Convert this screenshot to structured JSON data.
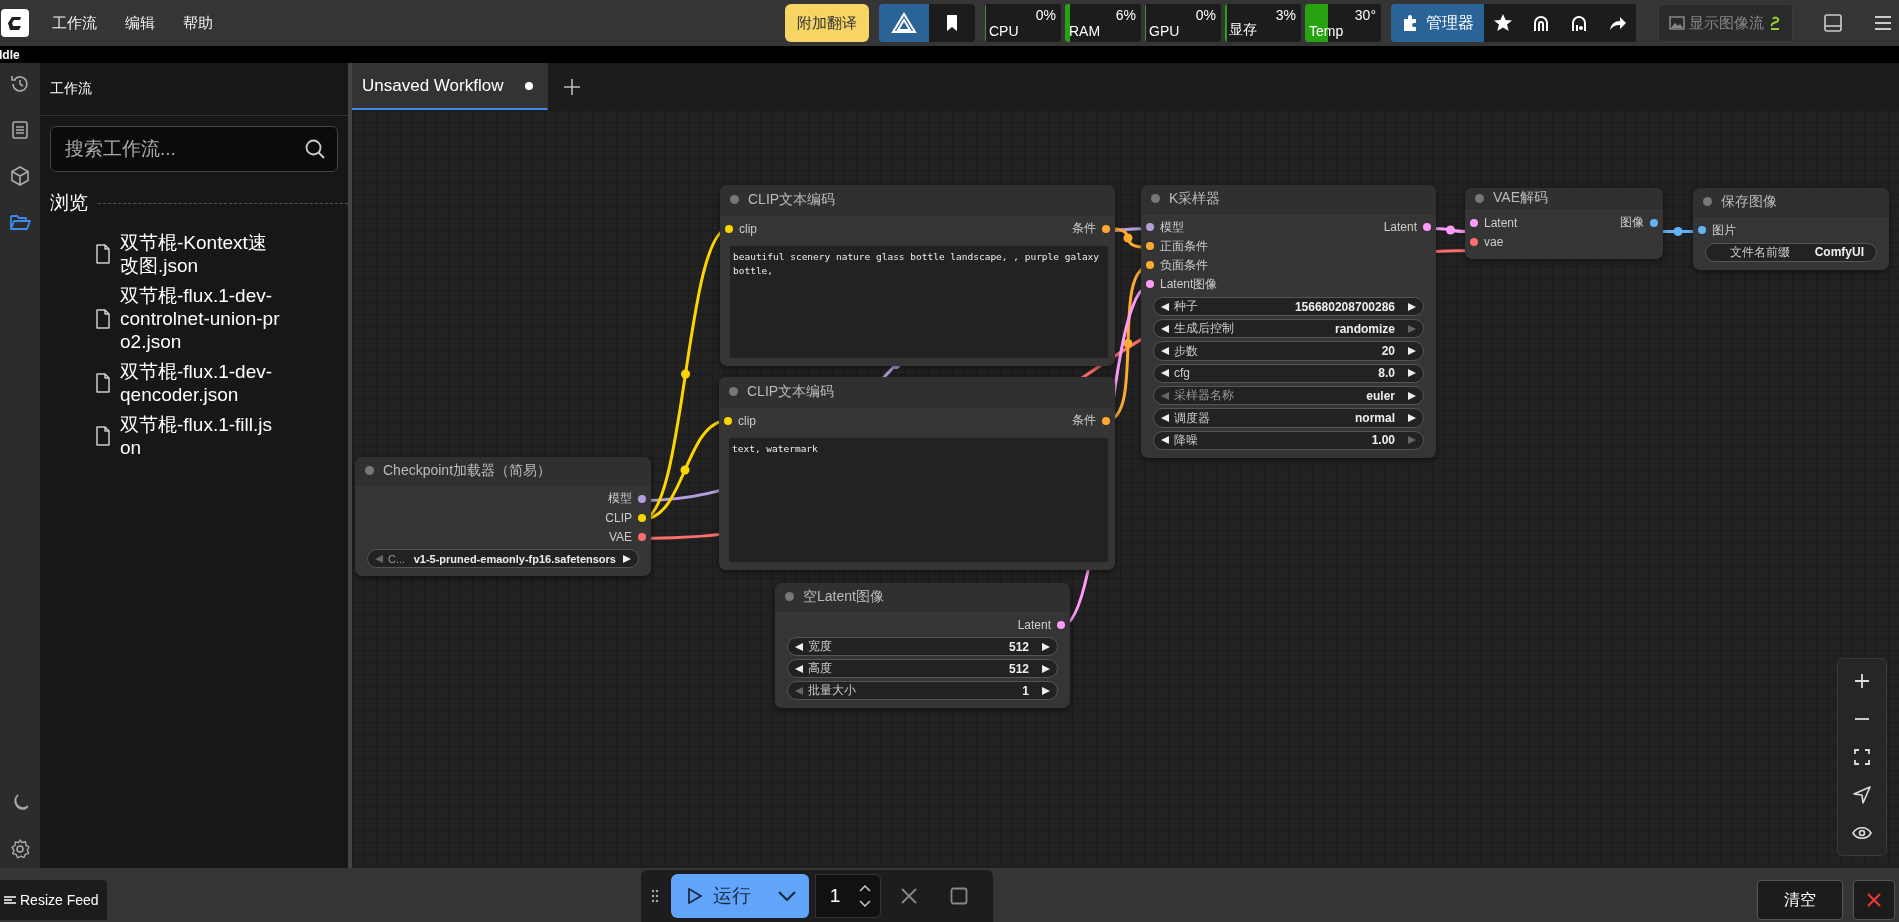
{
  "top_bar": {
    "menu": [
      {
        "label": "工作流"
      },
      {
        "label": "编辑"
      },
      {
        "label": "帮助"
      }
    ],
    "translate_button": "附加翻译",
    "monitors": [
      {
        "label": "CPU",
        "reading": "0%",
        "level": 0
      },
      {
        "label": "RAM",
        "reading": "6%",
        "level": 0.06
      },
      {
        "label": "GPU",
        "reading": "0%",
        "level": 0
      },
      {
        "label": "显存",
        "reading": "3%",
        "level": 0.03
      },
      {
        "label": "Temp",
        "reading": "30°",
        "level": 0.3
      }
    ],
    "manager_button": "管理器",
    "image_feed_button": "显示图像流"
  },
  "status": "Idle",
  "sidebar_tools": [
    {
      "kind": "history",
      "selected": false
    },
    {
      "kind": "queue",
      "selected": false
    },
    {
      "kind": "models",
      "selected": false
    },
    {
      "kind": "workflows",
      "selected": true
    }
  ],
  "workflows_panel": {
    "title": "工作流",
    "search": {
      "placeholder": "搜索工作流..."
    },
    "section": "浏览",
    "files": [
      "双节棍-Kontext速改图.json",
      "双节棍-flux.1-dev-controlnet-union-pro2.json",
      "双节棍-flux.1-dev-qencoder.json",
      "双节棍-flux.1-fill.json"
    ]
  },
  "tabs": [
    {
      "label": "Unsaved Workflow",
      "selected": true,
      "unsaved": true
    }
  ],
  "nodes": [
    {
      "title": "Checkpoint加载器（简易）",
      "outputs": [
        {
          "label": "模型",
          "color": "#b39ddb"
        },
        {
          "label": "CLIP",
          "color": "#ffd500"
        },
        {
          "label": "VAE",
          "color": "#ff6e6e"
        }
      ],
      "widgets": [
        {
          "kind": "combo",
          "label": "C...",
          "value": "v1-5-pruned-emaonly-fp16.safetensors",
          "at_min": true,
          "at_max": false
        }
      ]
    },
    {
      "title": "CLIP文本编码",
      "inputs": [
        {
          "label": "clip",
          "color": "#ffd500"
        }
      ],
      "outputs": [
        {
          "label": "条件",
          "color": "#ffa931"
        }
      ],
      "widgets": [
        {
          "kind": "textarea",
          "value": "beautiful scenery nature glass bottle landscape, , purple galaxy bottle,"
        }
      ]
    },
    {
      "title": "CLIP文本编码",
      "inputs": [
        {
          "label": "clip",
          "color": "#ffd500"
        }
      ],
      "outputs": [
        {
          "label": "条件",
          "color": "#ffa931"
        }
      ],
      "widgets": [
        {
          "kind": "textarea",
          "value": "text, watermark"
        }
      ]
    },
    {
      "title": "空Latent图像",
      "outputs": [
        {
          "label": "Latent",
          "color": "#ff9cf9"
        }
      ],
      "widgets": [
        {
          "kind": "number",
          "label": "宽度",
          "value": "512",
          "at_min": false,
          "at_max": false
        },
        {
          "kind": "number",
          "label": "高度",
          "value": "512",
          "at_min": false,
          "at_max": false
        },
        {
          "kind": "number",
          "label": "批量大小",
          "value": "1",
          "at_min": true,
          "at_max": false
        }
      ]
    },
    {
      "title": "K采样器",
      "inputs": [
        {
          "label": "模型",
          "color": "#b39ddb"
        },
        {
          "label": "正面条件",
          "color": "#ffa931"
        },
        {
          "label": "负面条件",
          "color": "#ffa931"
        },
        {
          "label": "Latent图像",
          "color": "#ff9cf9"
        }
      ],
      "outputs": [
        {
          "label": "Latent",
          "color": "#ff9cf9"
        }
      ],
      "widgets": [
        {
          "kind": "number",
          "label": "种子",
          "value": "156680208700286",
          "at_min": false,
          "at_max": false
        },
        {
          "kind": "combo",
          "label": "生成后控制",
          "value": "randomize",
          "at_min": false,
          "at_max": true
        },
        {
          "kind": "number",
          "label": "步数",
          "value": "20",
          "at_min": false,
          "at_max": false
        },
        {
          "kind": "number",
          "label": "cfg",
          "value": "8.0",
          "at_min": false,
          "at_max": false
        },
        {
          "kind": "combo",
          "label": "采样器名称",
          "value": "euler",
          "at_min": true,
          "at_max": false
        },
        {
          "kind": "combo",
          "label": "调度器",
          "value": "normal",
          "at_min": false,
          "at_max": false
        },
        {
          "kind": "number",
          "label": "降噪",
          "value": "1.00",
          "at_min": false,
          "at_max": true
        }
      ]
    },
    {
      "title": "VAE解码",
      "inputs": [
        {
          "label": "Latent",
          "color": "#ff9cf9"
        },
        {
          "label": "vae",
          "color": "#ff6e6e"
        }
      ],
      "outputs": [
        {
          "label": "图像",
          "color": "#64b5f6"
        }
      ]
    },
    {
      "title": "保存图像",
      "inputs": [
        {
          "label": "图片",
          "color": "#64b5f6"
        }
      ],
      "widgets": [
        {
          "kind": "text",
          "label": "文件名前缀",
          "value": "ComfyUI"
        }
      ]
    }
  ],
  "run_toolbar": {
    "run_button": "运行",
    "batch_count": "1"
  },
  "bottom": {
    "resize_feed": "Resize Feed",
    "clear_button": "清空"
  }
}
